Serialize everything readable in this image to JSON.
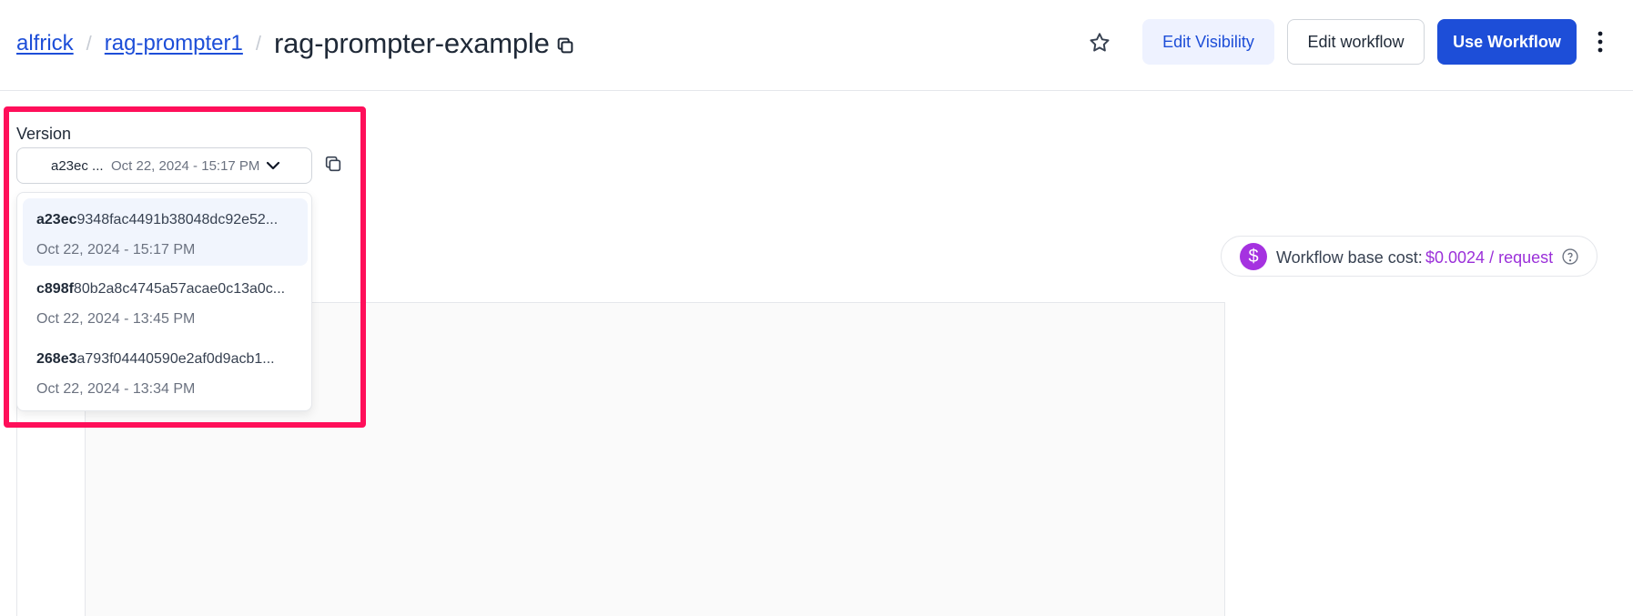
{
  "breadcrumb": {
    "user": "alfrick",
    "app": "rag-prompter1",
    "separator": "/",
    "workflow": "rag-prompter-example"
  },
  "header": {
    "edit_visibility": "Edit Visibility",
    "edit_workflow": "Edit workflow",
    "use_workflow": "Use Workflow",
    "accent_color": "#1d4ed8"
  },
  "version": {
    "label": "Version",
    "selected_hash": "a23ec ...",
    "selected_date": "Oct 22, 2024 - 15:17 PM",
    "options": [
      {
        "hash_bold": "a23ec",
        "hash_rest": "9348fac4491b38048dc92e52...",
        "date": "Oct 22, 2024 - 15:17 PM",
        "active": true
      },
      {
        "hash_bold": "c898f",
        "hash_rest": "80b2a8c4745a57acae0c13a0c...",
        "date": "Oct 22, 2024 - 13:45 PM",
        "active": false
      },
      {
        "hash_bold": "268e3",
        "hash_rest": "a793f04440590e2af0d9acb1...",
        "date": "Oct 22, 2024 - 13:34 PM",
        "active": false
      }
    ]
  },
  "cost": {
    "icon_glyph": "$",
    "label": "Workflow base cost:",
    "value": "$0.0024 / request",
    "color": "#9b30d9"
  },
  "highlight_color": "#ff0f5a"
}
